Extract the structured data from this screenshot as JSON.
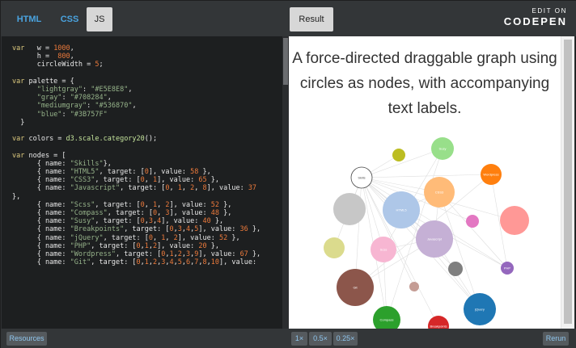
{
  "tabs": {
    "html": "HTML",
    "css": "CSS",
    "js": "JS",
    "result": "Result"
  },
  "branding": {
    "edit_on": "EDIT ON",
    "name": "CODEPEN"
  },
  "code_lines": [
    "var   w = 1000,",
    "      h =  800,",
    "      circleWidth = 5;",
    "",
    "var palette = {",
    "      \"lightgray\": \"#E5E8E8\",",
    "      \"gray\": \"#708284\",",
    "      \"mediumgray\": \"#536870\",",
    "      \"blue\": \"#3B757F\"",
    "  }",
    "",
    "var colors = d3.scale.category20();",
    "",
    "var nodes = [",
    "      { name: \"Skills\"},",
    "      { name: \"HTML5\", target: [0], value: 58 },",
    "      { name: \"CSS3\", target: [0, 1], value: 65 },",
    "      { name: \"Javascript\", target: [0, 1, 2, 8], value: 37",
    "},",
    "      { name: \"Scss\", target: [0, 1, 2], value: 52 },",
    "      { name: \"Compass\", target: [0, 3], value: 48 },",
    "      { name: \"Susy\", target: [0,3,4], value: 40 },",
    "      { name: \"Breakpoints\", target: [0,3,4,5], value: 36 },",
    "      { name: \"jQuery\", target: [0, 1, 2], value: 52 },",
    "      { name: \"PHP\", target: [0,1,2], value: 20 },",
    "      { name: \"Wordpress\", target: [0,1,2,3,9], value: 67 },",
    "      { name: \"Git\", target: [0,1,2,3,4,5,6,7,8,10], value:"
  ],
  "result": {
    "headline": "A force-directed draggable graph using circles as nodes, with accompanying text labels."
  },
  "graph_nodes": [
    {
      "label": "Skills",
      "color": "#ffffff",
      "stroke": "#444444"
    },
    {
      "label": "HTML5",
      "color": "#aec7e8"
    },
    {
      "label": "CSS3",
      "color": "#ffbb78"
    },
    {
      "label": "Javascript",
      "color": "#c5b0d5"
    },
    {
      "label": "Scss",
      "color": "#f7b6d2"
    },
    {
      "label": "Compass",
      "color": "#2ca02c"
    },
    {
      "label": "Susy",
      "color": "#98df8a"
    },
    {
      "label": "Breakpoints",
      "color": "#d62728"
    },
    {
      "label": "jQuery",
      "color": "#1f77b4"
    },
    {
      "label": "PHP",
      "color": "#9467bd"
    },
    {
      "label": "Wordpress",
      "color": "#ff7f0e"
    },
    {
      "label": "Git",
      "color": "#8c564b"
    },
    {
      "label": "",
      "color": "#c7c7c7"
    },
    {
      "label": "",
      "color": "#dbdb8d"
    },
    {
      "label": "",
      "color": "#ff9896"
    },
    {
      "label": "",
      "color": "#bcbd22"
    },
    {
      "label": "",
      "color": "#e377c2"
    },
    {
      "label": "",
      "color": "#7f7f7f"
    },
    {
      "label": "",
      "color": "#c49c94"
    }
  ],
  "bottom": {
    "resources": "Resources",
    "zoom_1x": "1×",
    "zoom_05x": "0.5×",
    "zoom_025x": "0.25×",
    "rerun": "Rerun"
  }
}
